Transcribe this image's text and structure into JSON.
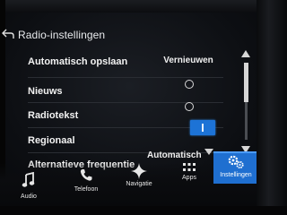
{
  "header": {
    "title": "Radio-instellingen",
    "back_icon": "back-arrow-icon"
  },
  "settings": {
    "autostore": {
      "label": "Automatisch opslaan",
      "button_label": "Vernieuwen"
    },
    "news": {
      "label": "Nieuws",
      "selected": false
    },
    "radiotext": {
      "label": "Radiotekst",
      "selected": false
    },
    "regional": {
      "label": "Regionaal",
      "enabled": true
    },
    "alternative_frequency": {
      "label": "Alternatieve frequentie",
      "value": "Automatisch"
    }
  },
  "scrollbar": {
    "up_icon": "scroll-up-arrow-icon",
    "down_icon": "scroll-down-arrow-icon"
  },
  "nav": [
    {
      "label": "Audio",
      "icon": "music-note-icon"
    },
    {
      "label": "Telefoon",
      "icon": "phone-icon"
    },
    {
      "label": "Navigatie",
      "icon": "navigation-star-icon"
    },
    {
      "label": "Apps",
      "icon": "apps-grid-icon"
    },
    {
      "label": "Instellingen",
      "icon": "gears-icon",
      "active": true
    }
  ],
  "colors": {
    "accent": "#1f6fd0",
    "text": "#f2f2f2",
    "background": "#0d0f13"
  }
}
